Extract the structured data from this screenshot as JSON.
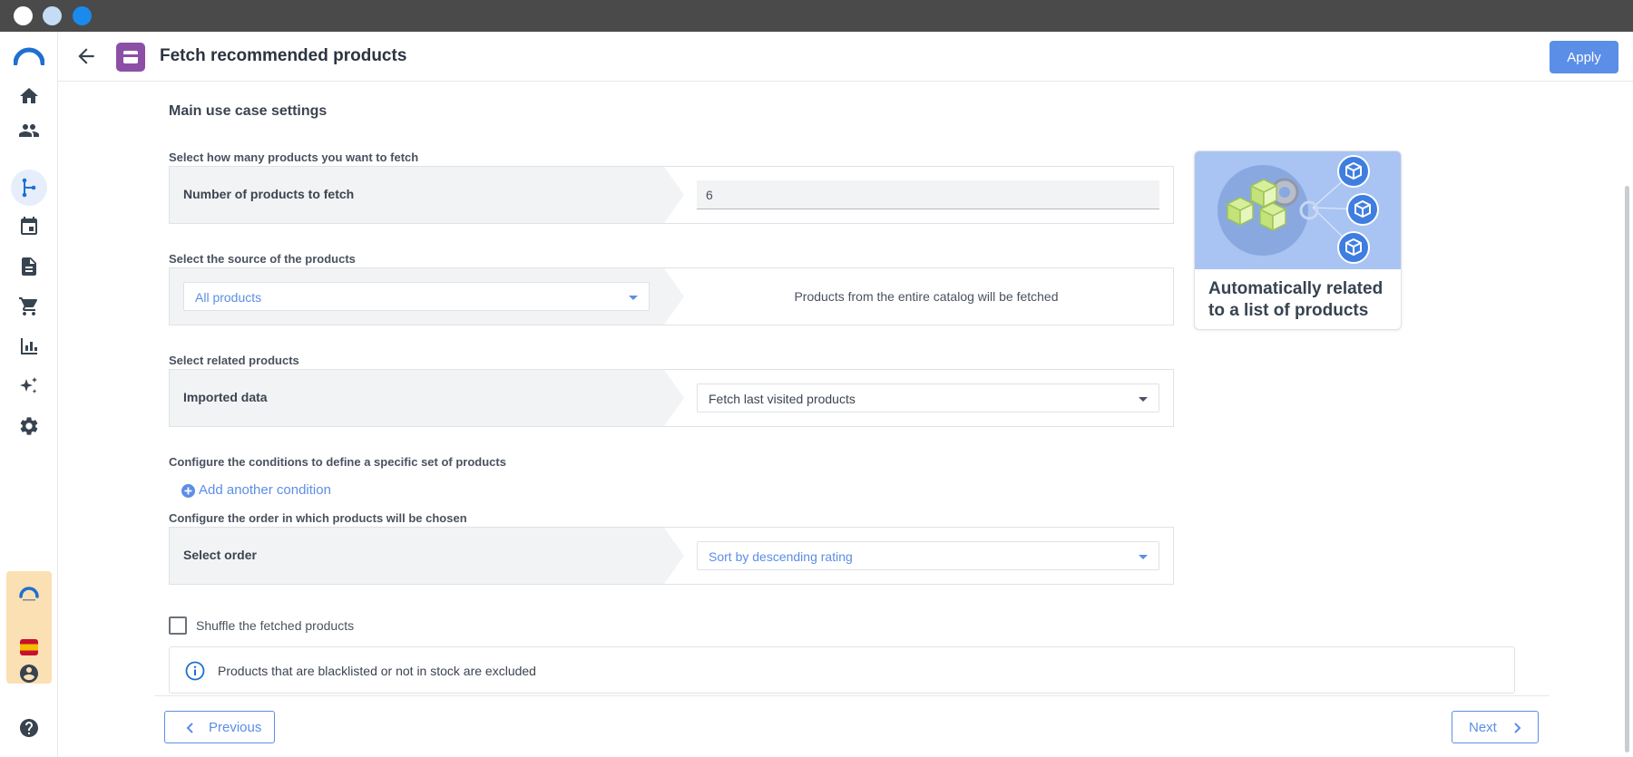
{
  "window": {
    "controls": [
      "close",
      "minimize",
      "maximize"
    ]
  },
  "sidebar": {
    "items": [
      {
        "name": "home",
        "icon": "home-icon"
      },
      {
        "name": "people",
        "icon": "people-icon"
      },
      {
        "name": "automation",
        "icon": "branch-icon",
        "active": true
      },
      {
        "name": "calendar",
        "icon": "calendar-icon"
      },
      {
        "name": "documents",
        "icon": "document-icon"
      },
      {
        "name": "cart",
        "icon": "cart-icon"
      },
      {
        "name": "analytics",
        "icon": "bar-chart-icon"
      },
      {
        "name": "ai",
        "icon": "sparkle-icon"
      },
      {
        "name": "settings",
        "icon": "gear-icon"
      }
    ]
  },
  "header": {
    "title": "Fetch recommended products",
    "apply_label": "Apply"
  },
  "main": {
    "section_title": "Main use case settings",
    "count": {
      "label": "Select how many products you want to fetch",
      "row_label": "Number of products to fetch",
      "value": "6"
    },
    "source": {
      "label": "Select the source of the products",
      "selected": "All products",
      "description": "Products from the entire catalog will be fetched"
    },
    "related": {
      "label": "Select related products",
      "row_label": "Imported data",
      "selected": "Fetch last visited products"
    },
    "conditions": {
      "label": "Configure the conditions to define a specific set of products",
      "add_label": "Add another condition"
    },
    "order": {
      "label": "Configure the order in which products will be chosen",
      "row_label": "Select order",
      "selected": "Sort by descending rating"
    },
    "shuffle": {
      "label": "Shuffle the fetched products",
      "checked": false
    },
    "info": {
      "text": "Products that are blacklisted or not in stock are excluded"
    }
  },
  "card": {
    "title": "Automatically related to a list of products"
  },
  "footer": {
    "previous_label": "Previous",
    "next_label": "Next"
  },
  "colors": {
    "accent": "#5b8ee6",
    "node_purple": "#8c4fa6",
    "titlebar": "#4a4a4a"
  }
}
